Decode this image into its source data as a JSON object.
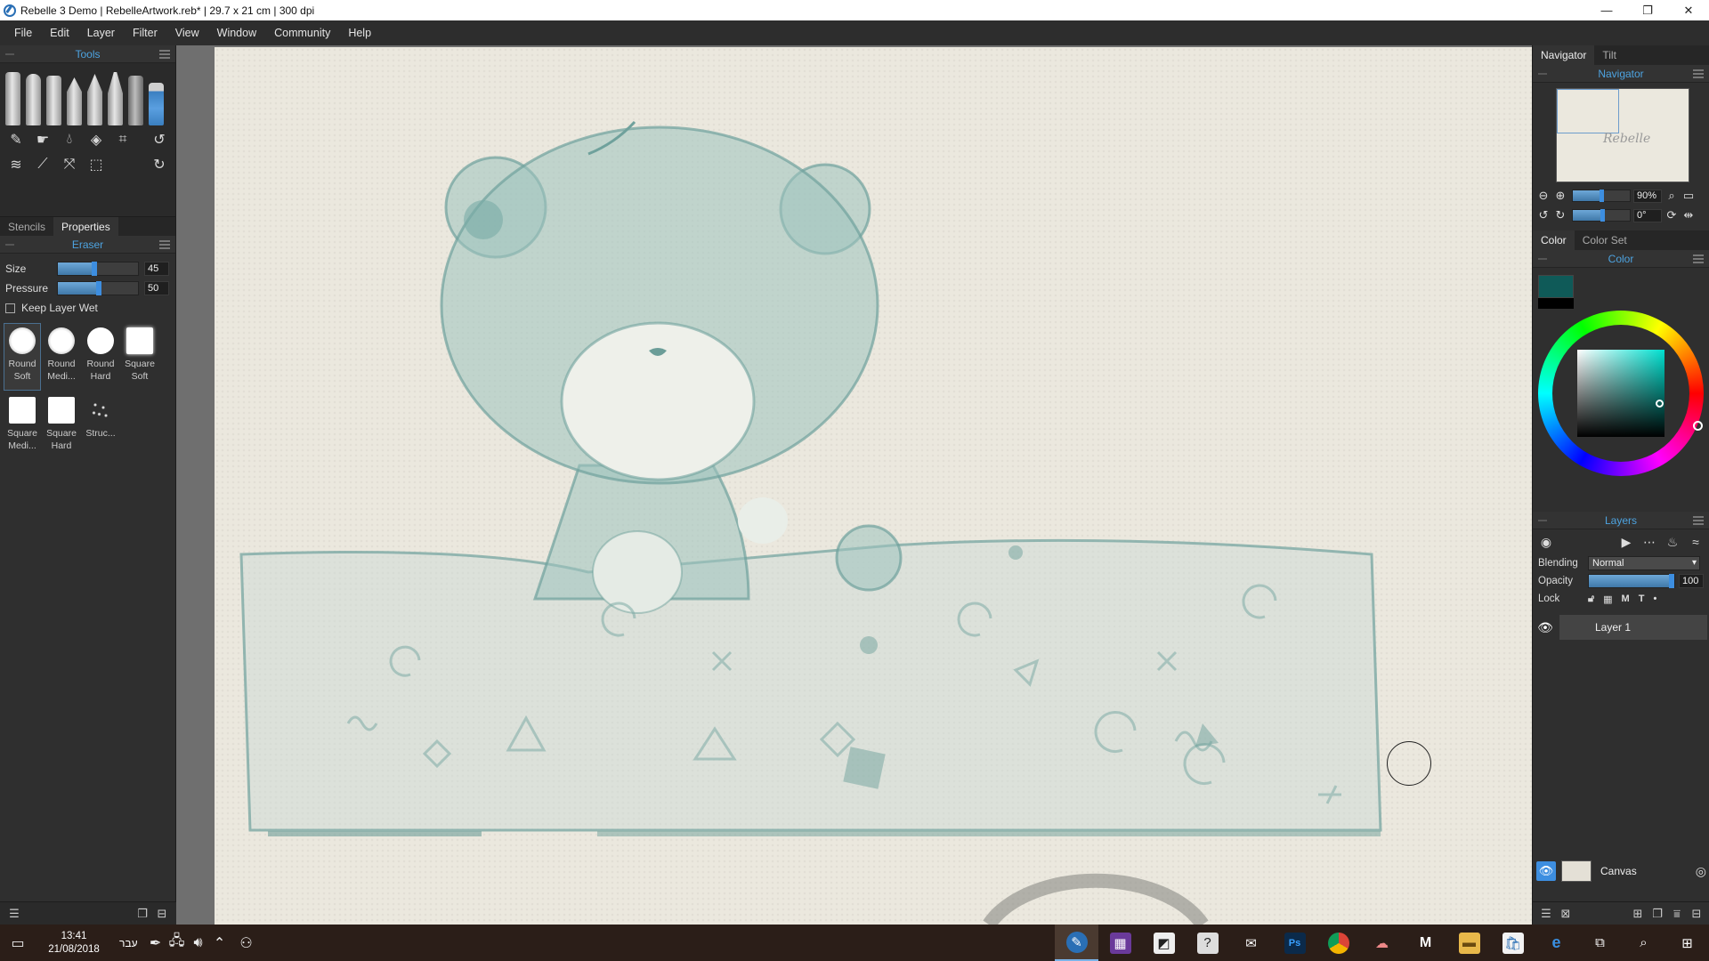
{
  "window": {
    "title": "Rebelle 3 Demo | RebelleArtwork.reb* | 29.7 x 21 cm | 300 dpi",
    "controls": [
      "—",
      "❐",
      "✕"
    ]
  },
  "menu": [
    "File",
    "Edit",
    "Layer",
    "Filter",
    "View",
    "Window",
    "Community",
    "Help"
  ],
  "tools_panel": {
    "title": "Tools",
    "icons": [
      "pencil-tool",
      "smudge-tool",
      "water-tool",
      "blend-tool",
      "crop-tool",
      "undo",
      "blow-tool",
      "eyedropper-tool",
      "transform-tool",
      "selection-tool",
      "redo"
    ]
  },
  "left_tabs": [
    "Stencils",
    "Properties"
  ],
  "properties": {
    "title": "Eraser",
    "size_label": "Size",
    "size_value": "45",
    "size_fraction": 0.45,
    "pressure_label": "Pressure",
    "pressure_value": "50",
    "pressure_fraction": 0.5,
    "keep_wet_label": "Keep Layer Wet",
    "presets": [
      {
        "line1": "Round",
        "line2": "Soft"
      },
      {
        "line1": "Round",
        "line2": "Medi..."
      },
      {
        "line1": "Round",
        "line2": "Hard"
      },
      {
        "line1": "Square",
        "line2": "Soft"
      },
      {
        "line1": "Square",
        "line2": "Medi..."
      },
      {
        "line1": "Square",
        "line2": "Hard"
      },
      {
        "line1": "Struc...",
        "line2": ""
      }
    ]
  },
  "right_tabs_top": [
    "Navigator",
    "Tilt"
  ],
  "navigator": {
    "title": "Navigator",
    "zoom": "90%",
    "rotation": "0°",
    "preview_signature": "Rebelle"
  },
  "color_tabs": [
    "Color",
    "Color Set"
  ],
  "color": {
    "title": "Color",
    "foreground": "#0f5a58",
    "background": "#000000"
  },
  "layers": {
    "title": "Layers",
    "blending_label": "Blending",
    "blending_value": "Normal",
    "opacity_label": "Opacity",
    "opacity_value": "100",
    "lock_label": "Lock",
    "lock_flags": [
      "M",
      "T"
    ],
    "items": [
      "Layer 1"
    ],
    "canvas_label": "Canvas"
  },
  "taskbar": {
    "time": "13:41",
    "date": "21/08/2018",
    "language": "עבר"
  },
  "colors": {
    "accent": "#4da3e0",
    "paint": "#5f9a98"
  }
}
